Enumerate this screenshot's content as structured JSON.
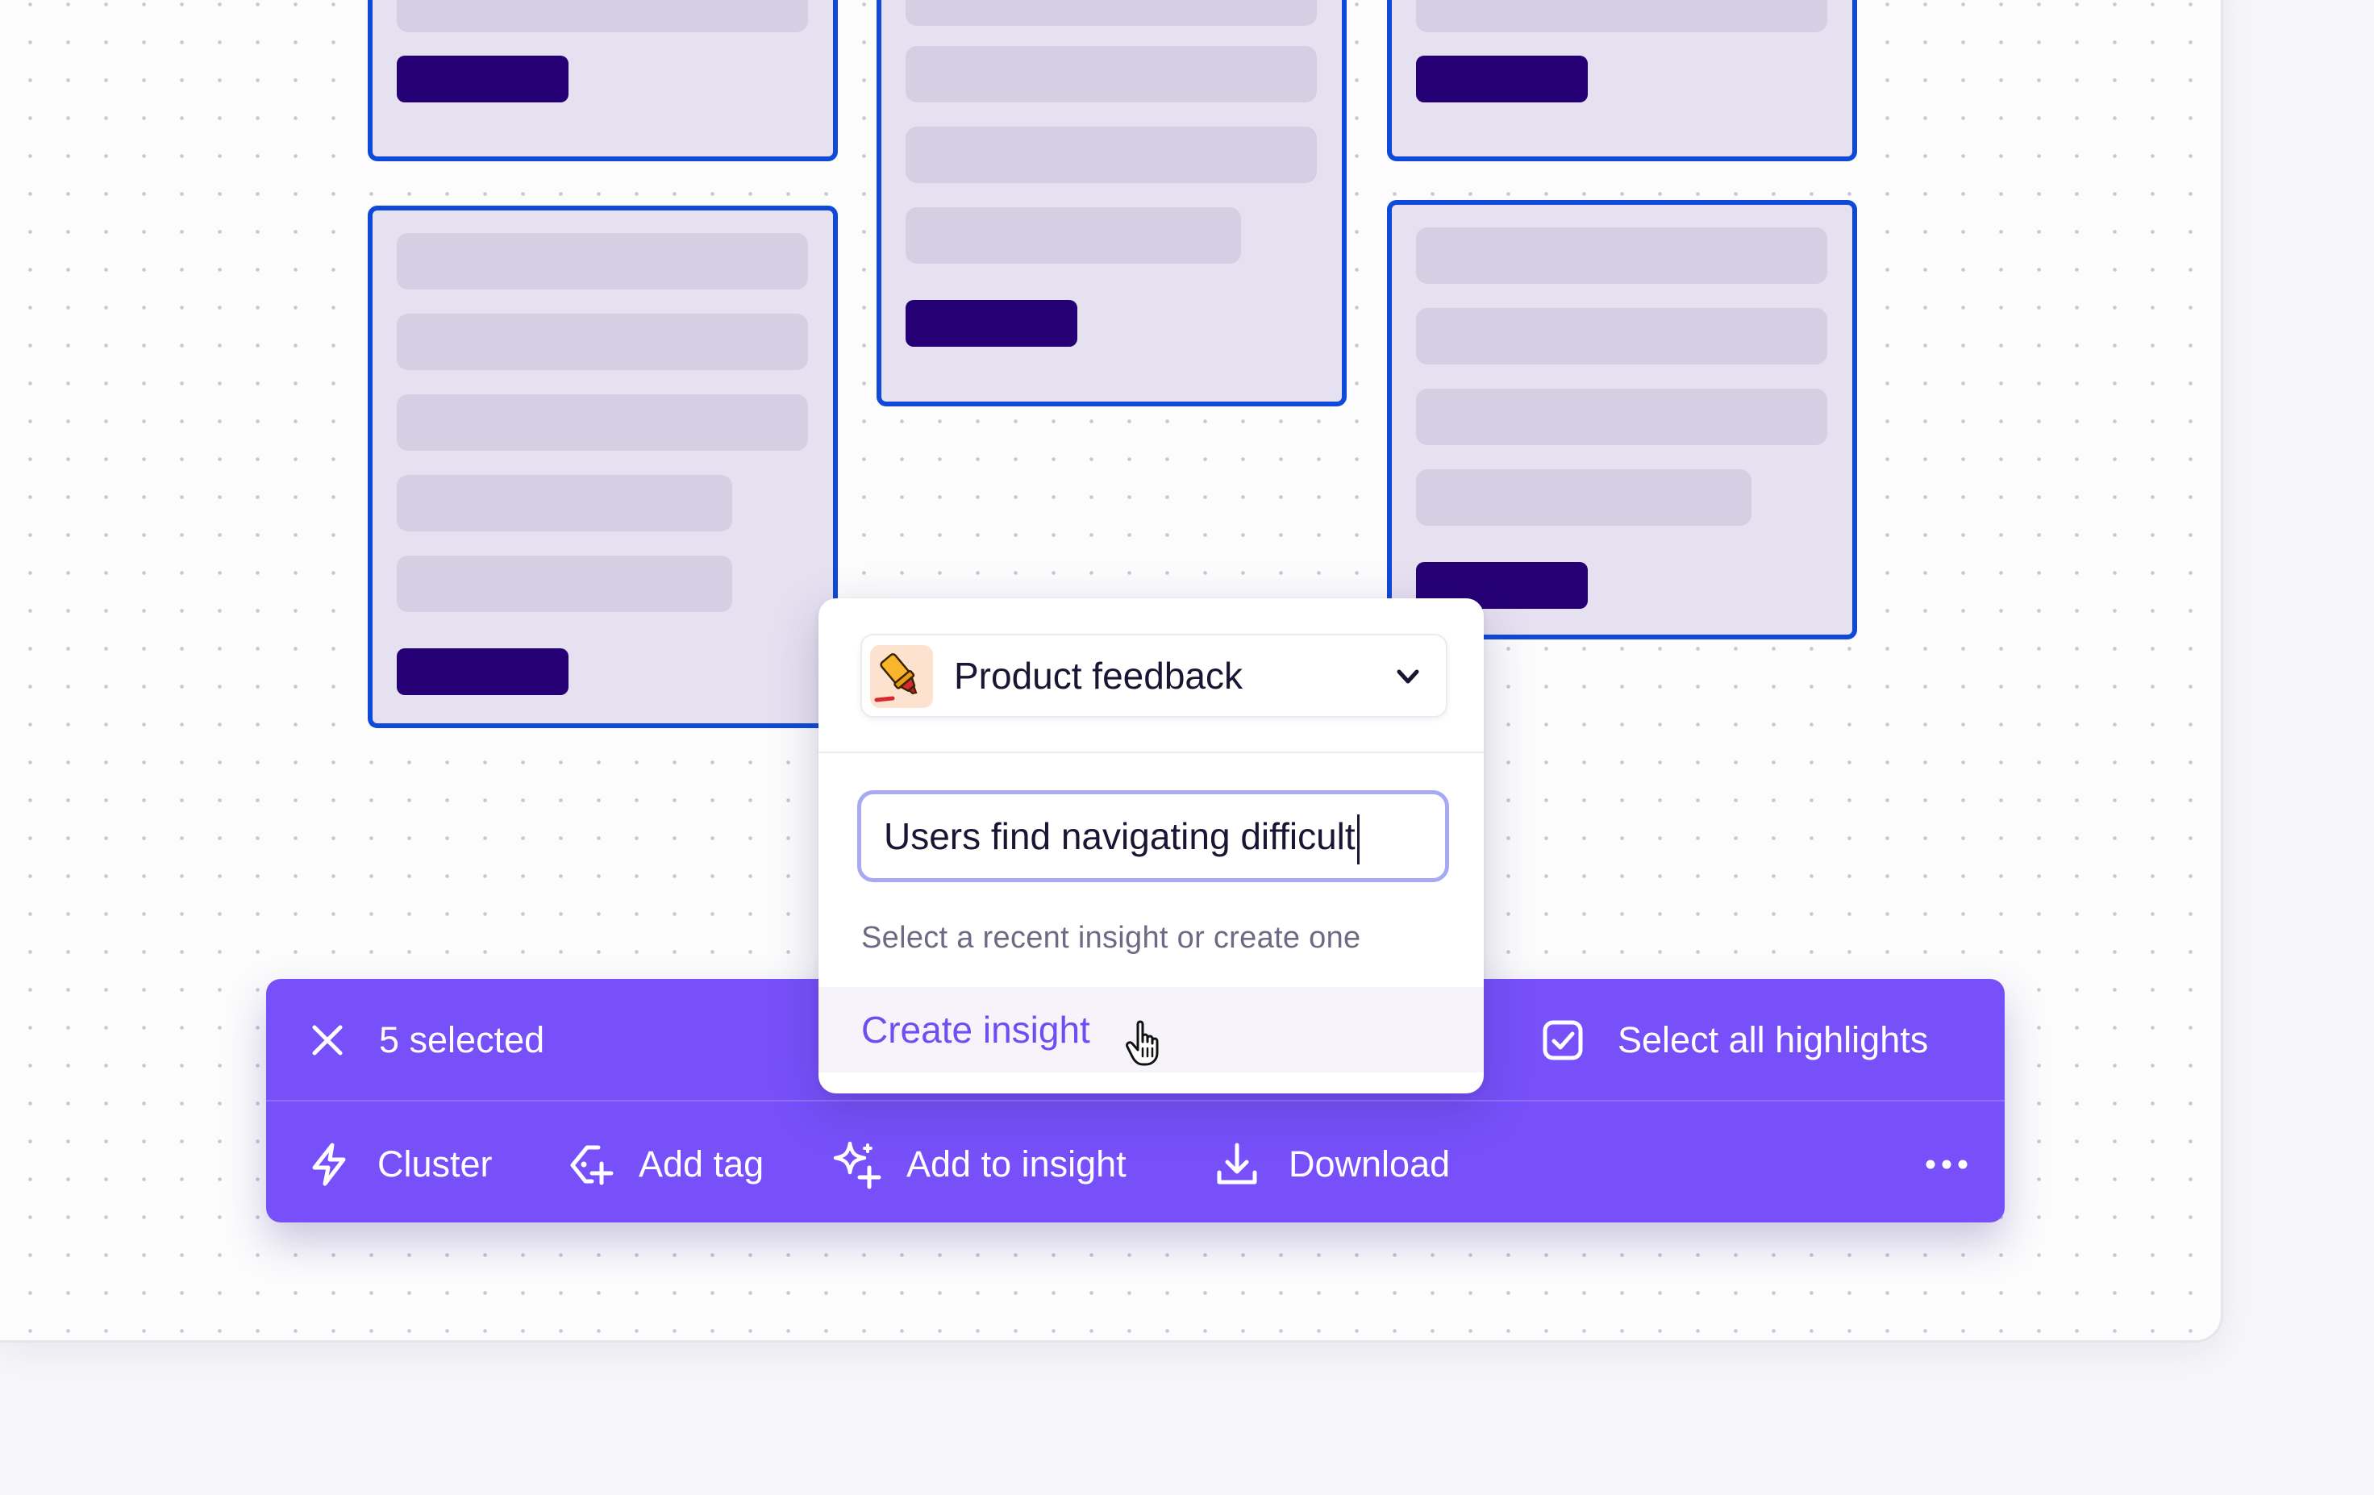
{
  "canvas": {
    "cards": [
      {
        "id": "c1",
        "bars": [
          "full"
        ],
        "has_button": true
      },
      {
        "id": "c2",
        "bars": [
          "full",
          "full",
          "full",
          "short"
        ],
        "has_button": true
      },
      {
        "id": "c3",
        "bars": [
          "full"
        ],
        "has_button": true
      },
      {
        "id": "c4",
        "bars": [
          "full",
          "full",
          "full",
          "short",
          "short"
        ],
        "has_button": true
      },
      {
        "id": "c5",
        "bars": [
          "full",
          "full",
          "full",
          "short"
        ],
        "has_button": true
      }
    ]
  },
  "toolbar": {
    "selection_count_label": "5 selected",
    "select_all_label": "Select all highlights",
    "actions": {
      "cluster": "Cluster",
      "add_tag": "Add tag",
      "add_to_insight": "Add to insight",
      "download": "Download"
    },
    "icons": [
      "close-icon",
      "checkbox-checked-icon",
      "lightning-icon",
      "tag-plus-icon",
      "sparkle-plus-icon",
      "download-icon",
      "more-icon"
    ]
  },
  "popover": {
    "project": {
      "name": "Product feedback",
      "icon": "highlighter-icon"
    },
    "input": {
      "value": "Users find navigating difficult"
    },
    "hint": "Select a recent insight or create one",
    "create_label": "Create insight"
  },
  "colors": {
    "toolbar_bg": "#7750FA",
    "card_border": "#0F49D9",
    "card_bg": "#E6E1F1",
    "card_button": "#250075",
    "accent_text": "#6F4DF2"
  }
}
